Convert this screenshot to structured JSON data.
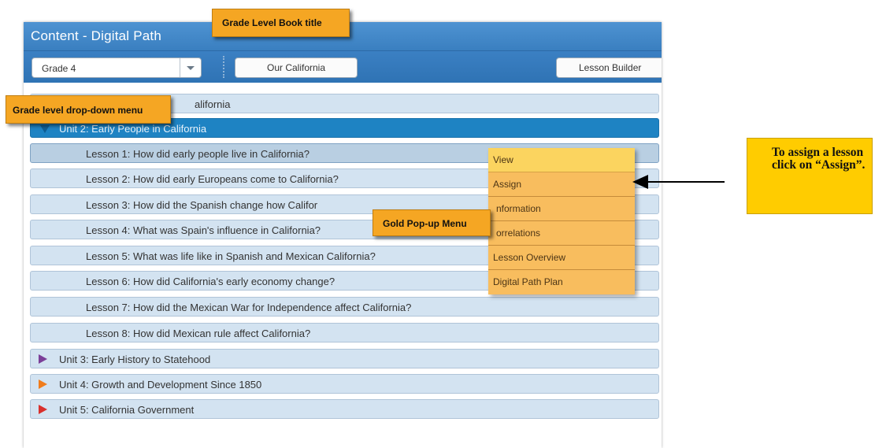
{
  "window": {
    "title": "Content - Digital Path"
  },
  "toolbar": {
    "grade_select": {
      "value": "Grade 4"
    },
    "book_title_button": "Our California",
    "lesson_builder_button": "Lesson Builder"
  },
  "units": [
    {
      "label": "Unit 1: California",
      "visible_label": "alifornia",
      "state": "collapsed"
    },
    {
      "label": "Unit 2: Early People in California",
      "state": "expanded",
      "selected": true
    },
    {
      "label": "Unit 3: Early History to Statehood",
      "state": "collapsed",
      "color": "#7b3f98"
    },
    {
      "label": "Unit 4: Growth and Development Since 1850",
      "state": "collapsed",
      "color": "#f07c1b"
    },
    {
      "label": "Unit 5: California Government",
      "state": "collapsed",
      "color": "#d9302c"
    }
  ],
  "lessons": [
    {
      "label": "Lesson 1: How did early people live in California?",
      "selected": true
    },
    {
      "label": "Lesson 2: How did early Europeans come to California?"
    },
    {
      "label": "Lesson 3: How did the Spanish change how Califor"
    },
    {
      "label": "Lesson 4: What was Spain's influence in California?"
    },
    {
      "label": "Lesson 5: What was life like in Spanish and Mexican California?"
    },
    {
      "label": "Lesson 6: How did California's early economy change?"
    },
    {
      "label": "Lesson 7: How did the Mexican War for Independence affect California?"
    },
    {
      "label": "Lesson 8: How did Mexican rule affect California?"
    }
  ],
  "popup_menu": {
    "items": [
      {
        "label": "View"
      },
      {
        "label": "Assign"
      },
      {
        "label": "nformation"
      },
      {
        "label": "orrelations"
      },
      {
        "label": "Lesson Overview"
      },
      {
        "label": "Digital Path Plan"
      }
    ]
  },
  "annotations": {
    "book_title_callout": "Grade Level Book title",
    "dropdown_callout": "Grade level drop-down menu",
    "popup_callout": "Gold Pop-up Menu",
    "assign_note": "To assign a lesson click on “Assign”."
  },
  "colors": {
    "titlebar": "#3f86c8",
    "selected_unit": "#1e83c3",
    "row_background": "#d3e3f1",
    "popup": "#f8bd5e",
    "callout": "#f5a623",
    "note": "#ffcc00"
  }
}
